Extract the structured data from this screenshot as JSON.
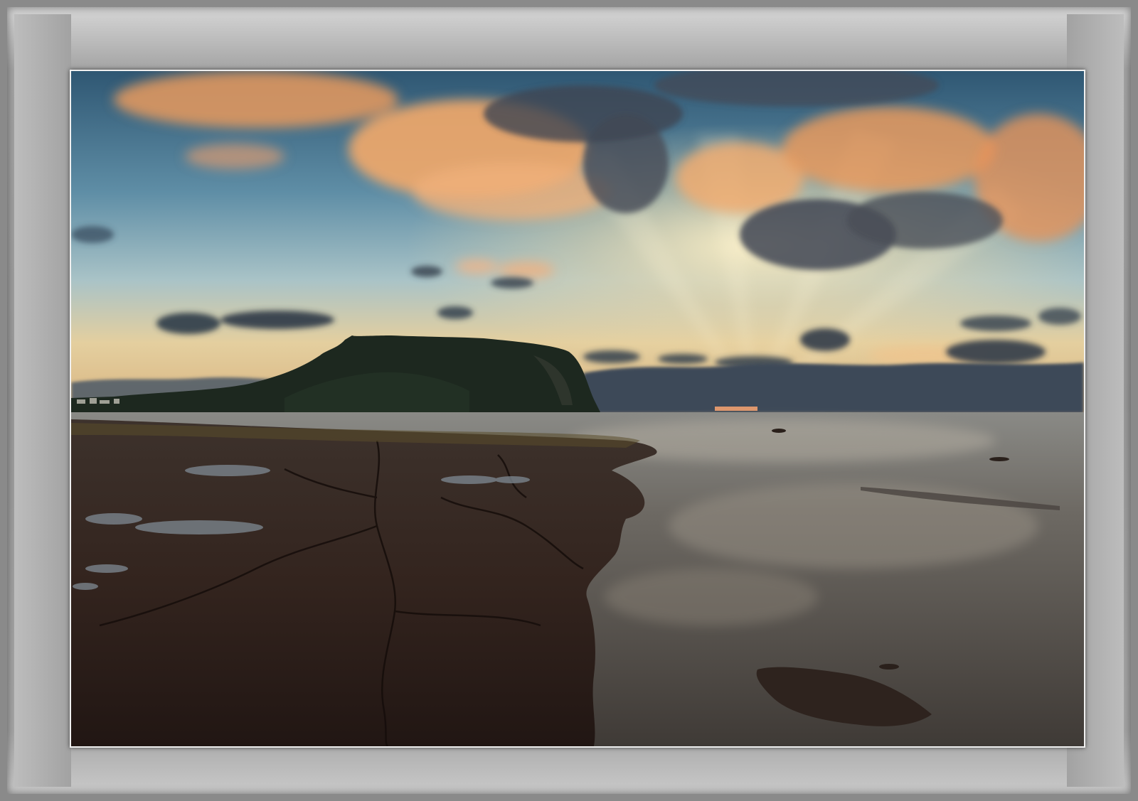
{
  "image": {
    "scene": "coastal-sunset-landscape",
    "colors": {
      "sky_top": "#3f6f8f",
      "sky_mid": "#8fb4c4",
      "sky_glow": "#f2dcae",
      "cloud_warm": "#f0a768",
      "cloud_dark": "#3b4552",
      "mountain": "#1e2a22",
      "sea": "#6d6a66",
      "rock": "#3a2a24",
      "frame": "#9e9e9e"
    }
  }
}
